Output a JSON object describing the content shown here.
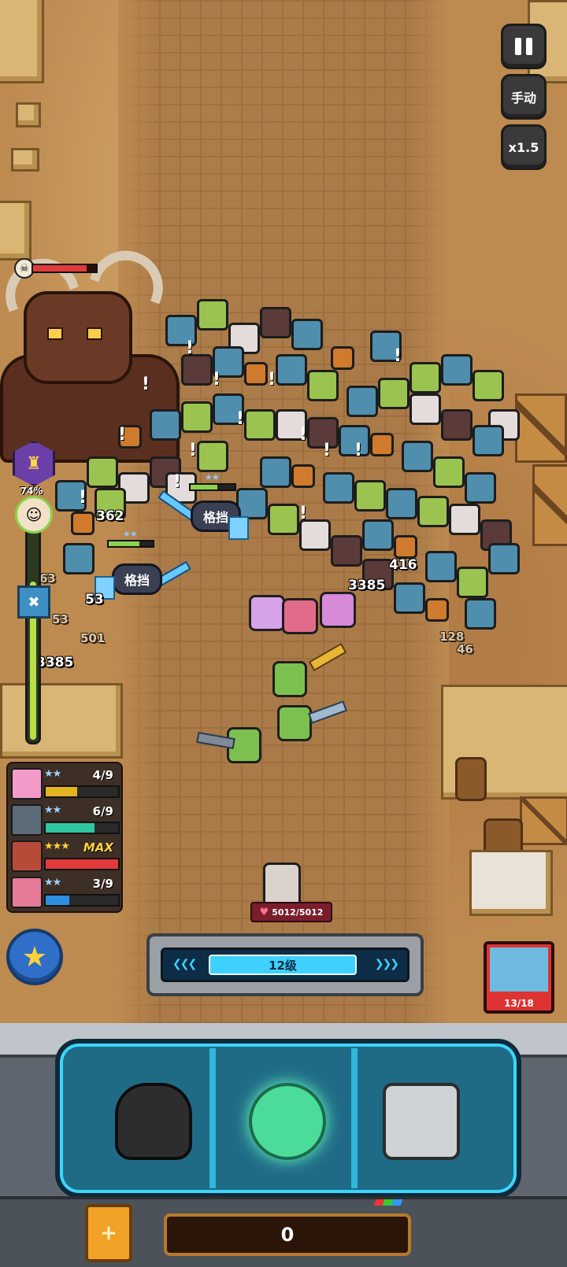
{
  "controls": {
    "pause_icon": "pause-icon",
    "mode_label": "手动",
    "speed_label": "x1.5"
  },
  "progress": {
    "percent_label": "74%",
    "fraction": 0.74
  },
  "combat": {
    "block_labels": [
      "格挡",
      "格挡"
    ],
    "damage_numbers": [
      "362",
      "416",
      "3385",
      "53",
      "501",
      "3385",
      "63",
      "53",
      "128",
      "46"
    ]
  },
  "heroes": [
    {
      "stars": "★★",
      "level": "4/9",
      "bar_color": "#e3b322",
      "fill": 0.44
    },
    {
      "stars": "★★",
      "level": "6/9",
      "bar_color": "#2fc7a0",
      "fill": 0.67
    },
    {
      "stars": "★★★",
      "level": "MAX",
      "bar_color": "#e03a3a",
      "fill": 1.0
    },
    {
      "stars": "★★",
      "level": "3/9",
      "bar_color": "#2d8fe0",
      "fill": 0.33
    }
  ],
  "player": {
    "hp_label": "5012/5012"
  },
  "level": {
    "label": "12级",
    "fill": 0.9
  },
  "portrait": {
    "count_label": "13/18"
  },
  "bottom": {
    "counter_value": "0"
  },
  "colors": {
    "accent_cyan": "#3bd6ff",
    "hp_red": "#e23b3b",
    "gold": "#ffd23e"
  }
}
